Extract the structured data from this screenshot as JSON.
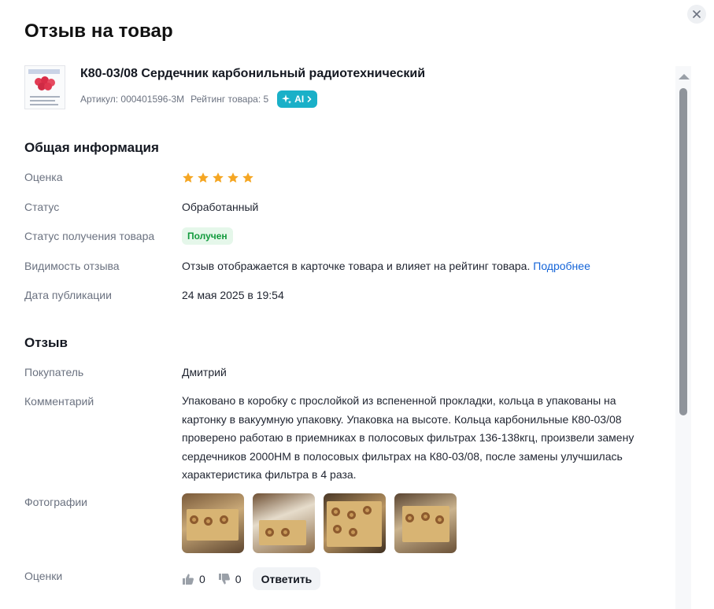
{
  "title": "Отзыв на товар",
  "close_icon": "close-icon",
  "product": {
    "name": "К80-03/08 Сердечник карбонильный радиотехнический",
    "article": "Артикул: 000401596-3М",
    "rating": "Рейтинг товара: 5",
    "ai_label": "AI"
  },
  "general": {
    "heading": "Общая информация",
    "rating_label": "Оценка",
    "stars": 5,
    "status_label": "Статус",
    "status_value": "Обработанный",
    "receipt_label": "Статус получения товара",
    "receipt_value": "Получен",
    "visibility_label": "Видимость отзыва",
    "visibility_value": "Отзыв отображается в карточке товара и влияет на рейтинг товара.",
    "visibility_link": "Подробнее",
    "date_label": "Дата публикации",
    "date_value": "24 мая 2025 в 19:54"
  },
  "review": {
    "heading": "Отзыв",
    "buyer_label": "Покупатель",
    "buyer_value": "Дмитрий",
    "comment_label": "Комментарий",
    "comment_value": "Упаковано в коробку с прослойкой из вспененной прокладки, кольца в упакованы на картонку в вакуумную упаковку. Упаковка на высоте. Кольца карбонильные К80-03/08 проверено работаю в приемниках в полосовых фильтрах 136-138кгц, произвели замену сердечников 2000НМ в полосовых фильтрах на К80-03/08, после замены улучшилась характеристика фильтра в 4 раза.",
    "photos_label": "Фотографии",
    "photos_count": 4,
    "votes_label": "Оценки",
    "likes": "0",
    "dislikes": "0",
    "reply_label": "Ответить"
  },
  "colors": {
    "accent_ai": "#1ab0c8",
    "star": "#f5a623",
    "received_bg": "#e5f7ea",
    "received_text": "#119a3c",
    "link": "#1464d8"
  }
}
